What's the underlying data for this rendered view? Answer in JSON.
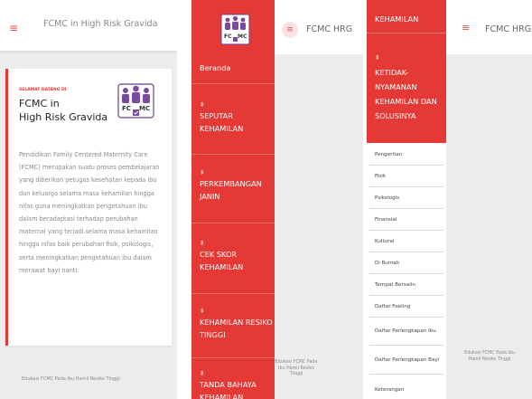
{
  "panel1": {
    "app_title": "FCMC in High Risk Gravida",
    "welcome": "SELAMAT DATANG DI",
    "card_title": "FCMC in\nHigh Risk Gravida",
    "description": "Pendidikan Family Centered Maternity Care (FCMC) merupakan suatu proses pembelajaran yang diberikan petugas kesehatan kepada ibu dan keluarga selama masa kehamilan hingga nifas guna meningkatkan pengetahuan ibu dalam beradaptasi terhadap perubahan maternal yang terjadi selama masa kehamilan hingga nifas baik perubahan fisik, psikologis, serta meningkatkan pengetahuan ibu dalam merawat bayi nanti.",
    "footer": "Edukasi FCMC Pada Ibu Hamil Resiko Tinggi"
  },
  "panel2": {
    "app_title": "FCMC HRG",
    "nav": [
      {
        "label": "Beranda"
      },
      {
        "label": "SEPUTAR KEHAMILAN"
      },
      {
        "label": "PERKEMBANGAN JANIN"
      },
      {
        "label": "CEK SKOR KEHAMILAN"
      },
      {
        "label": "KEHAMILAN RESIKO TINGGI"
      },
      {
        "label": "TANDA BAHAYA KEHAMILAN"
      }
    ],
    "footer": "Edukasi FCMC Pada Ibu Hamil Resiko Tinggi"
  },
  "panel3": {
    "app_title": "FCMC HRG",
    "top_label": "KEHAMILAN",
    "section_label": "KETIDAK-NYAMANAN KEHAMILAN DAN SOLUSINYA",
    "sub_items": [
      "Pengertian",
      "Fisik",
      "Psikologis",
      "Finansial",
      "Kultural",
      "Di Rumah",
      "Tempat Bersalin",
      "Daftar Feeling",
      "Daftar Perlengkapan Ibu",
      "Daftar Perlengkapan Bayi",
      "Keterangan"
    ],
    "footer": "Edukasi FCMC Pada Ibu Hamil Resiko Tinggi"
  },
  "icons": {
    "menu": "hamburger-menu-icon",
    "nav_arrow": "double-up-arrow-icon",
    "logo": "fcmc-family-logo"
  },
  "colors": {
    "accent_red": "#e53935",
    "menu_icon": "#d9534f",
    "background": "#ececec",
    "text_gray": "#8a8a8a"
  }
}
